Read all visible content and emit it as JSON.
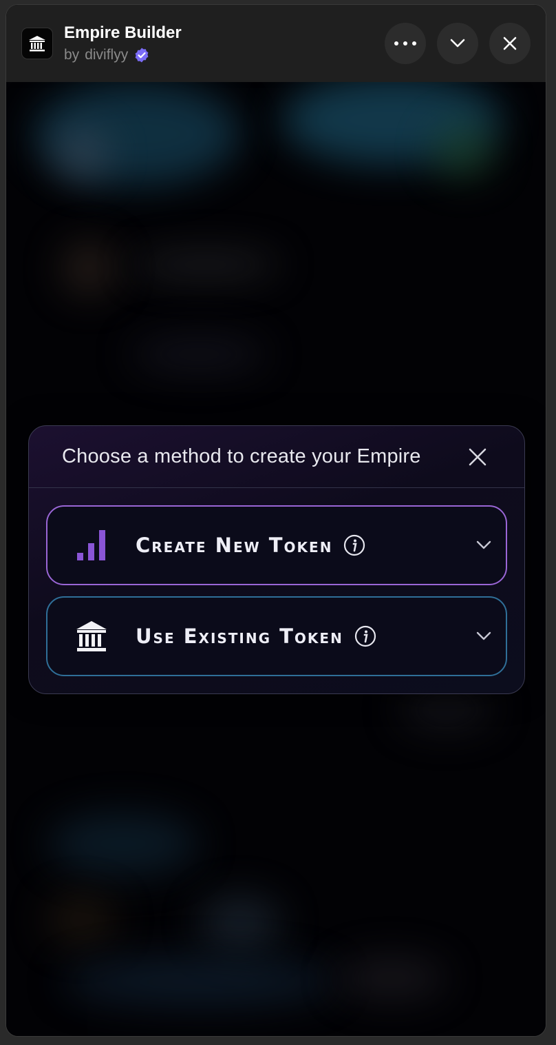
{
  "header": {
    "title": "Empire Builder",
    "byline_prefix": "by",
    "author": "diviflyy",
    "icons": {
      "app": "bank-icon",
      "verified": "verified-badge-icon",
      "more": "more-horizontal-icon",
      "collapse": "chevron-down-icon",
      "close": "close-icon"
    }
  },
  "modal": {
    "title": "Choose a method to create your Empire",
    "options": [
      {
        "label": "Create New Token",
        "icon": "signal-bars-icon",
        "accent": "#9a66d6"
      },
      {
        "label": "Use Existing Token",
        "icon": "bank-icon",
        "accent": "#2f6f98"
      }
    ]
  }
}
